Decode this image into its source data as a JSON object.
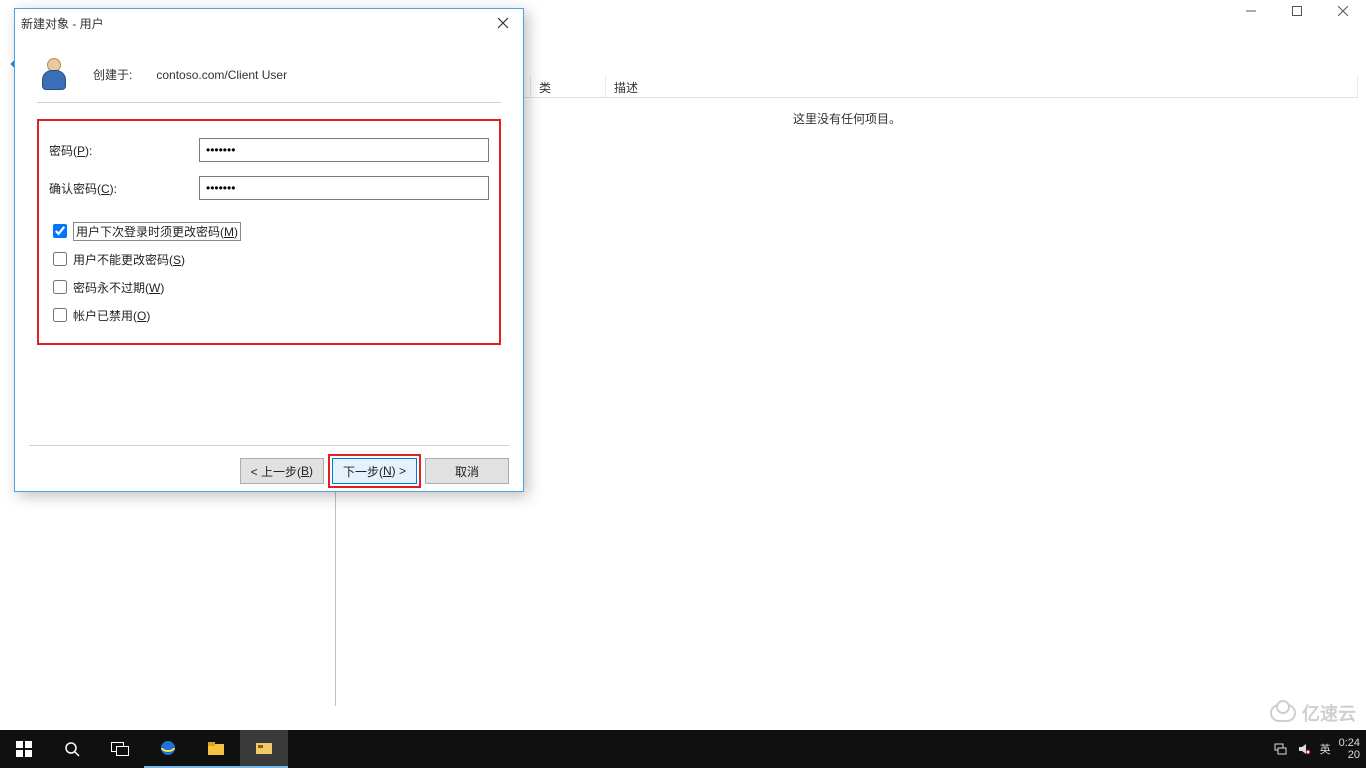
{
  "main_window": {
    "columns": {
      "c1": "",
      "c2": "",
      "c3": "描述"
    },
    "col2_fragment_visible": "类",
    "empty_message": "这里没有任何项目。"
  },
  "dialog": {
    "title": "新建对象 - 用户",
    "create_in_label": "创建于:",
    "create_in_path": "contoso.com/Client User",
    "password": {
      "label_prefix": "密码(",
      "label_hotkey": "P",
      "label_suffix": "):",
      "value": "●●●●●●●"
    },
    "confirm": {
      "label_prefix": "确认密码(",
      "label_hotkey": "C",
      "label_suffix": "):",
      "value": "●●●●●●●"
    },
    "checks": {
      "must_change": {
        "checked": true,
        "pre": "用户下次登录时须更改密码(",
        "hot": "M",
        "post": ")"
      },
      "cannot_change": {
        "checked": false,
        "pre": "用户不能更改密码(",
        "hot": "S",
        "post": ")"
      },
      "never_expire": {
        "checked": false,
        "pre": "密码永不过期(",
        "hot": "W",
        "post": ")"
      },
      "disabled": {
        "checked": false,
        "pre": "帐户已禁用(",
        "hot": "O",
        "post": ")"
      }
    },
    "buttons": {
      "back": {
        "pre": "< 上一步(",
        "hot": "B",
        "post": ")"
      },
      "next": {
        "pre": "下一步(",
        "hot": "N",
        "post": ") >"
      },
      "cancel": {
        "label": "取消"
      }
    }
  },
  "taskbar": {
    "ime": "英",
    "time": "0:24",
    "date_fragment": "20"
  },
  "watermark": "亿速云"
}
